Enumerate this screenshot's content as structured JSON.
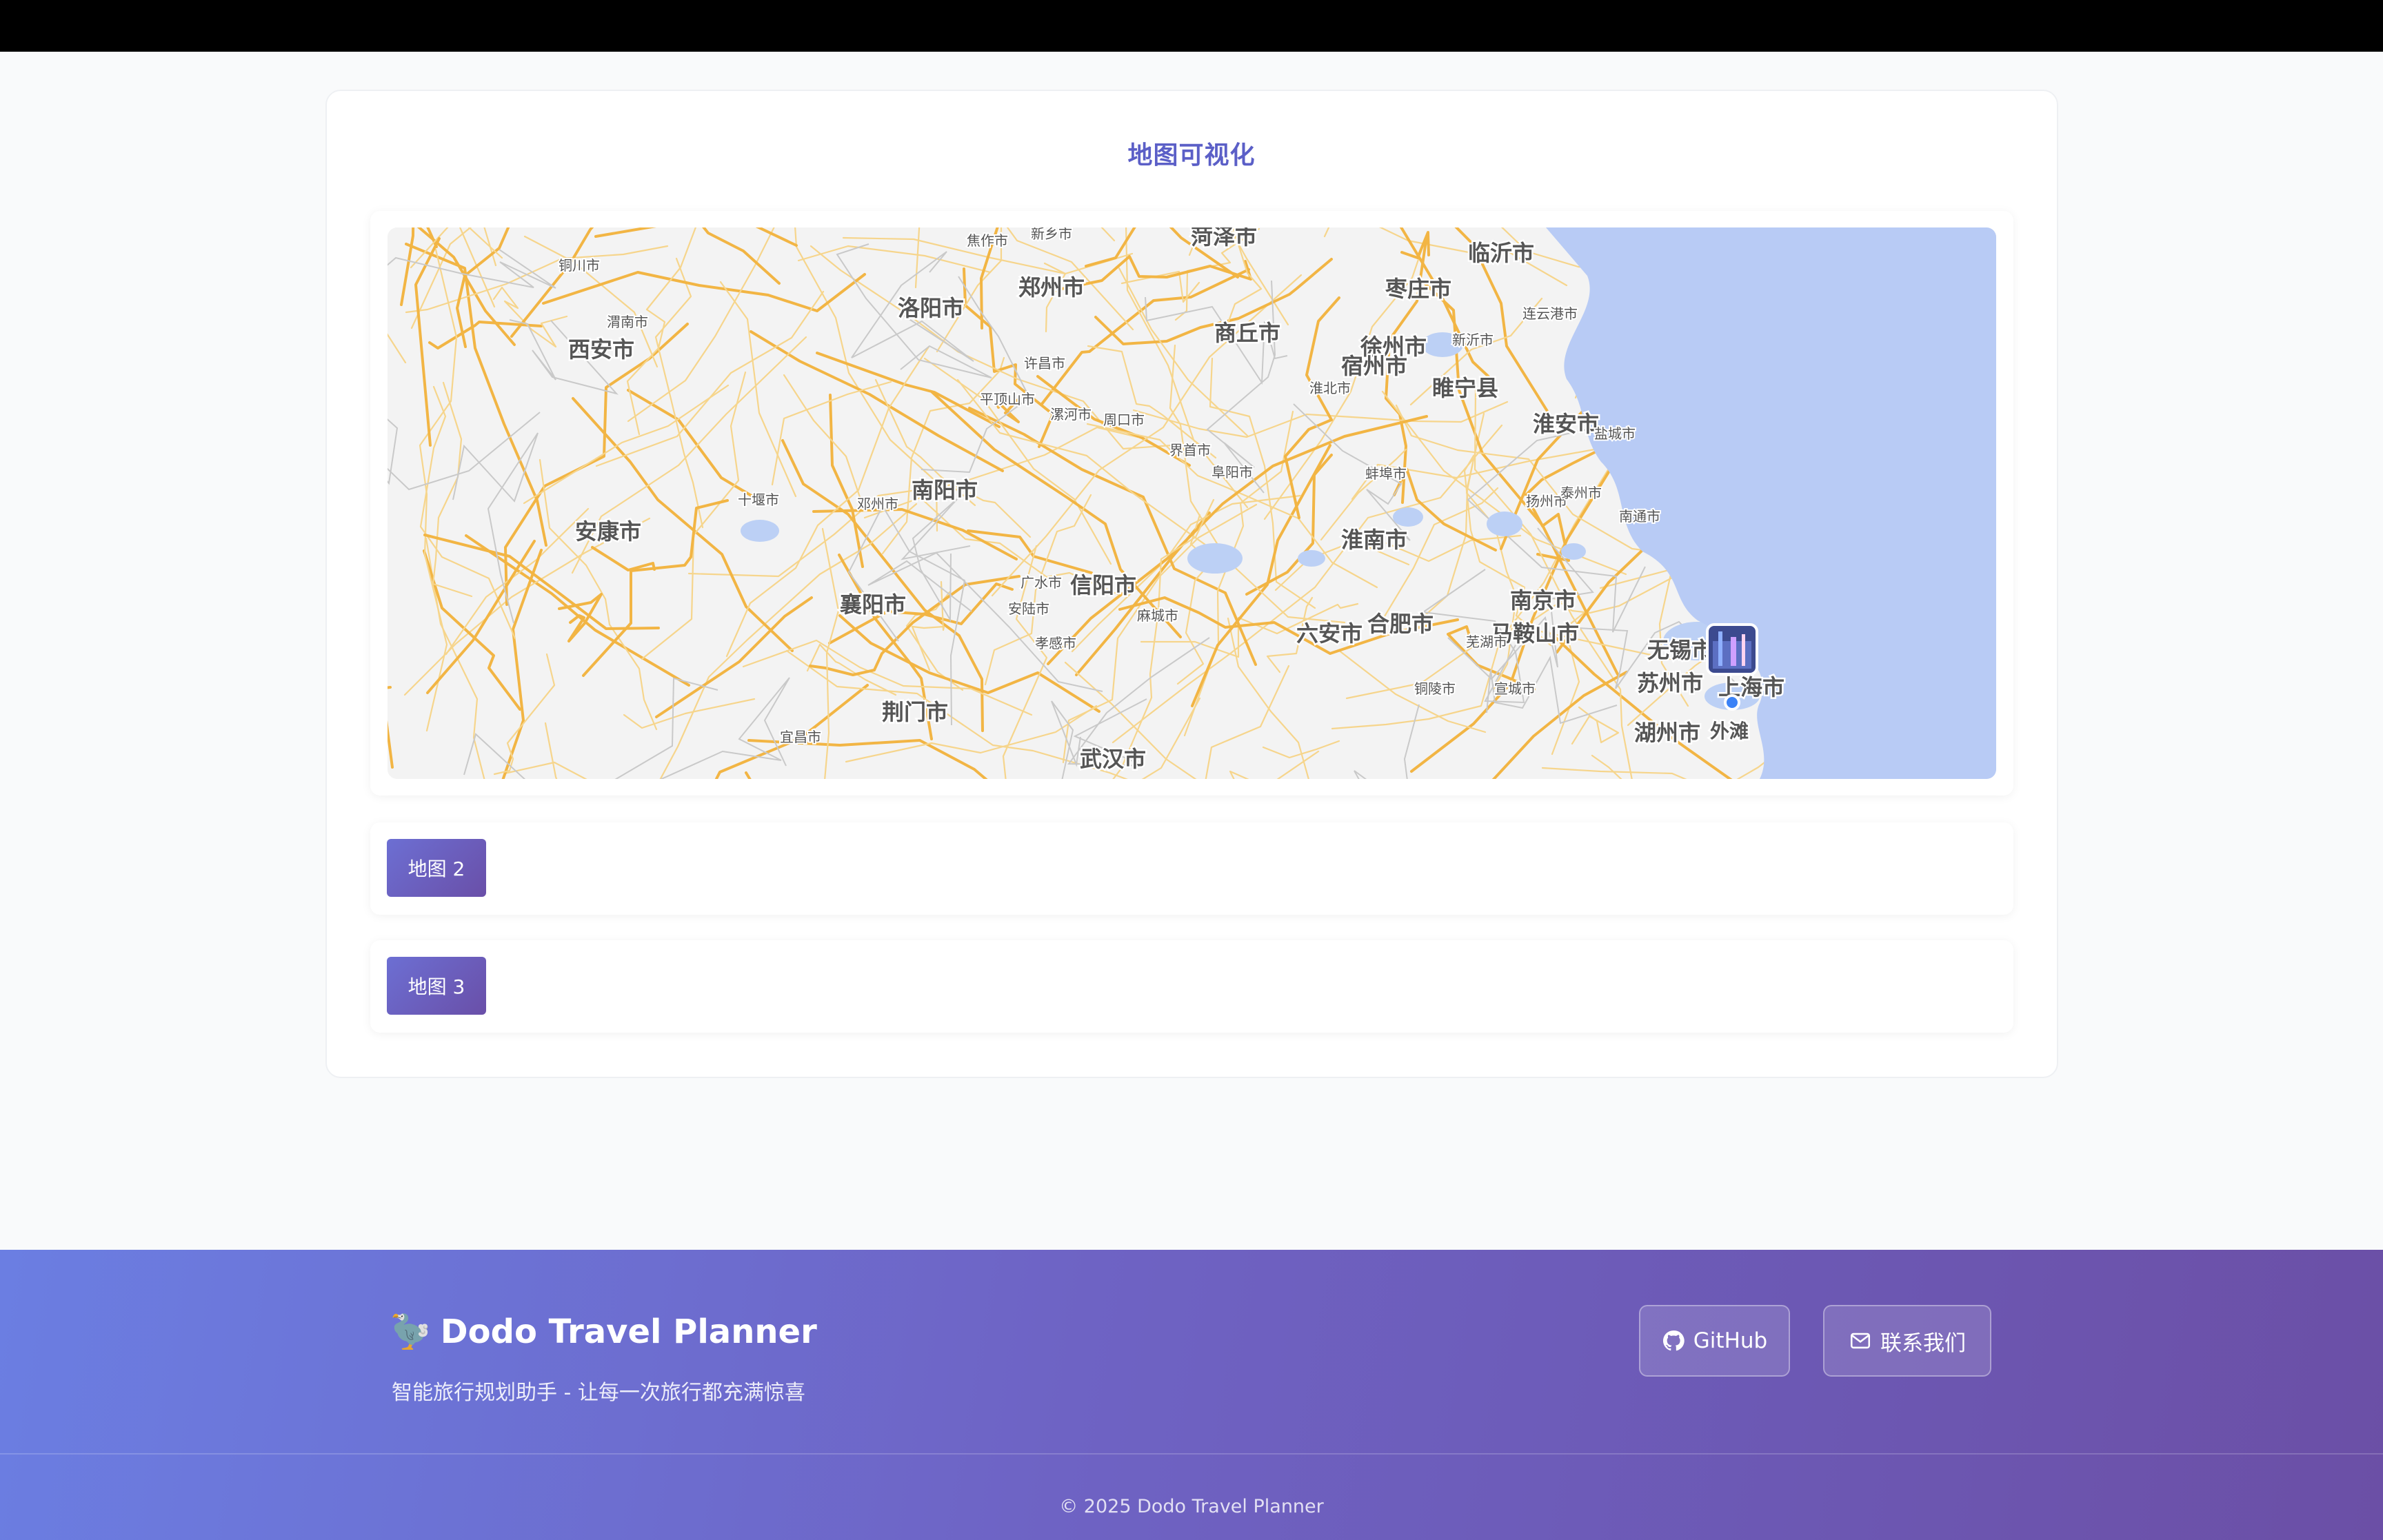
{
  "page": {
    "title": "地图可视化"
  },
  "map": {
    "cities_major": [
      "菏泽市",
      "临沂市",
      "枣庄市",
      "郑州市",
      "洛阳市",
      "商丘市",
      "西安市",
      "徐州市",
      "睢宁县",
      "宿州市",
      "淮安市",
      "南阳市",
      "安康市",
      "淮南市",
      "信阳市",
      "南京市",
      "襄阳市",
      "六安市",
      "合肥市",
      "马鞍山市",
      "无锡市",
      "苏州市",
      "上海市",
      "荆门市",
      "湖州市",
      "武汉市"
    ],
    "cities_minor": [
      "焦作市",
      "新乡市",
      "铜川市",
      "渭南市",
      "连云港市",
      "新沂市",
      "许昌市",
      "淮北市",
      "平顶山市",
      "漯河市",
      "周口市",
      "界首市",
      "盐城市",
      "阜阳市",
      "蚌埠市",
      "十堰市",
      "邓州市",
      "扬州市",
      "泰州市",
      "南通市",
      "广水市",
      "芜湖市",
      "安陆市",
      "麻城市",
      "孝感市",
      "铜陵市",
      "宣城市",
      "宜昌市"
    ],
    "poi_label": "外滩"
  },
  "buttons": {
    "map2": "地图 2",
    "map3": "地图 3"
  },
  "footer": {
    "brand_emoji": "🦤",
    "brand": "Dodo Travel Planner",
    "tagline": "智能旅行规划助手 - 让每一次旅行都充满惊喜",
    "github": "GitHub",
    "contact": "联系我们",
    "copyright": "© 2025 Dodo Travel Planner"
  },
  "colors": {
    "accent": "#5b5fc7",
    "road": "#f2b544",
    "sea": "#b8cbf5"
  }
}
